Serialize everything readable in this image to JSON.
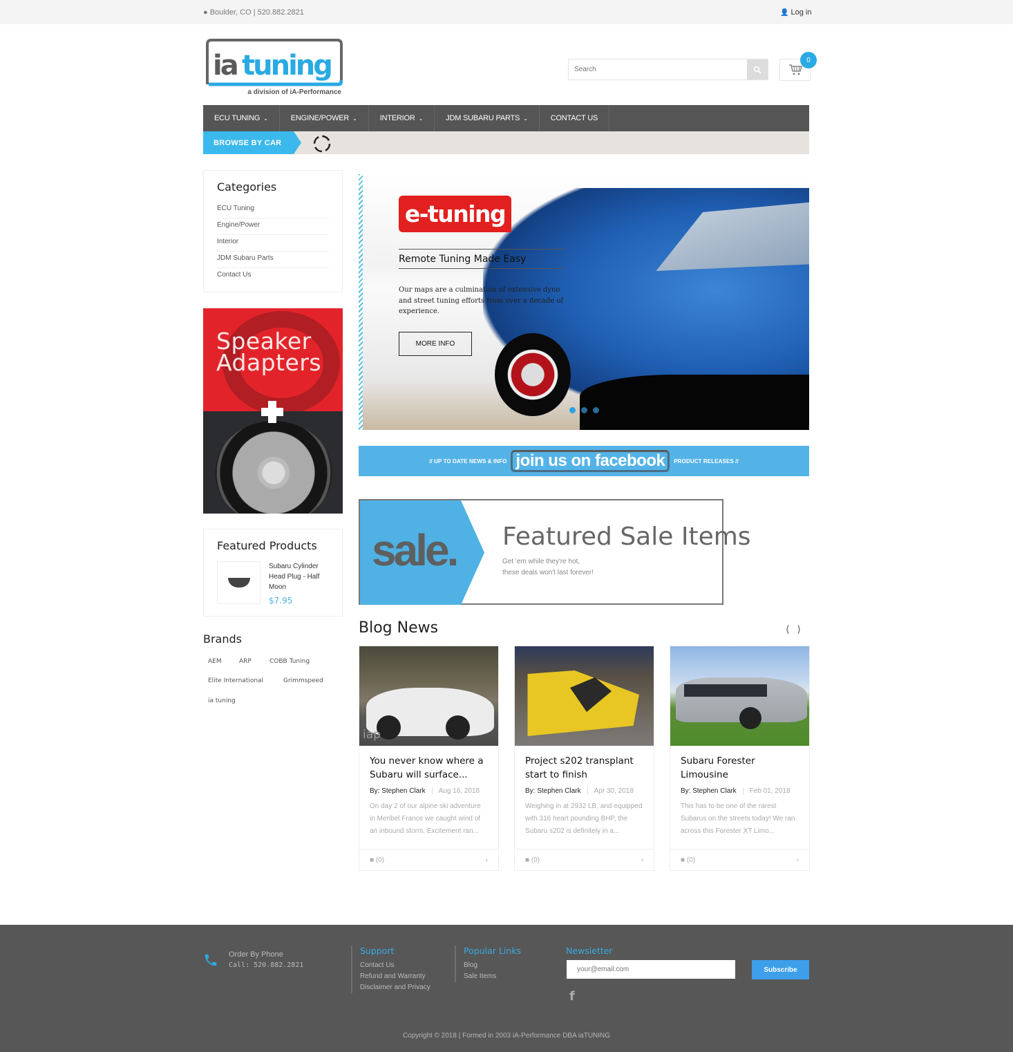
{
  "topbar": {
    "location": "Boulder, CO | 520.882.2821",
    "login": "Log in"
  },
  "logo": {
    "brand_left": "ia",
    "brand_right": "tuning",
    "tagline": "a division of iA-Performance"
  },
  "search": {
    "placeholder": "Search"
  },
  "cart": {
    "count": "0"
  },
  "colors": {
    "accent": "#29aae2",
    "nav_bg": "#555555",
    "footer_bg": "#575757",
    "etuning_red": "#e1201f"
  },
  "nav": {
    "items": [
      {
        "label": "ECU TUNING",
        "dropdown": true
      },
      {
        "label": "ENGINE/POWER",
        "dropdown": true
      },
      {
        "label": "INTERIOR",
        "dropdown": true
      },
      {
        "label": "JDM SUBARU PARTS",
        "dropdown": true
      },
      {
        "label": "CONTACT US",
        "dropdown": false
      }
    ],
    "browse_label": "BROWSE BY CAR"
  },
  "sidebar": {
    "categories_title": "Categories",
    "categories": [
      "ECU Tuning",
      "Engine/Power",
      "Interior",
      "JDM Subaru Parts",
      "Contact Us"
    ],
    "promo_line1": "Speaker",
    "promo_line2": "Adapters",
    "featured_title": "Featured Products",
    "featured_product": {
      "name": "Subaru Cylinder Head Plug - Half Moon",
      "price": "$7.95"
    },
    "brands_title": "Brands",
    "brands": [
      "AEM",
      "ARP",
      "COBB Tuning",
      "Elite International",
      "Grimmspeed",
      "ia tuning"
    ]
  },
  "slider": {
    "badge": "e-tuning",
    "heading": "Remote Tuning Made Easy",
    "text": "Our maps are a culmination of extensive dyno and street tuning efforts from over a decade of experience.",
    "button": "MORE INFO",
    "slide_count": 3,
    "active_slide": 1
  },
  "facebook_banner": {
    "left": "// UP TO DATE NEWS & INFO",
    "center": "join us on facebook",
    "right": "PRODUCT RELEASES //"
  },
  "sale_banner": {
    "word": "sale.",
    "title": "Featured Sale Items",
    "sub1": "Get 'em while they're hot,",
    "sub2": "these deals won't last forever!"
  },
  "blog": {
    "title": "Blog News",
    "posts": [
      {
        "title": "You never know where a Subaru will surface...",
        "author": "By: Stephen Clark",
        "date": "Aug 16, 2018",
        "excerpt": "On day 2 of our alpine ski adventure in Meribel France we caught wind of an inbound storm. Excitement ran...",
        "comments": "(0)",
        "watermark": "iap"
      },
      {
        "title": "Project s202 transplant start to finish",
        "author": "By: Stephen Clark",
        "date": "Apr 30, 2018",
        "excerpt": "Weighing in at  2932 LB, and equipped with 316 heart pounding BHP, the Subaru s202 is definitely in a...",
        "comments": "(0)"
      },
      {
        "title": "Subaru Forester Limousine",
        "author": "By: Stephen Clark",
        "date": "Feb 01, 2018",
        "excerpt": "This has to be one of the rarest Subarus on the streets today! We ran across this Forester XT Limo...",
        "comments": "(0)"
      }
    ]
  },
  "footer": {
    "order_label": "Order By Phone",
    "order_phone": "Call: 520.882.2821",
    "support_title": "Support",
    "support_links": [
      "Contact Us",
      "Refund and Warranty",
      "Disclaimer and Privacy"
    ],
    "popular_title": "Popular Links",
    "popular_links": [
      "Blog",
      "Sale Items"
    ],
    "newsletter_title": "Newsletter",
    "email_placeholder": "your@email.com",
    "subscribe": "Subscribe",
    "copyright": "Copyright © 2018 | Formed in 2003 iA-Performance DBA iaTUNING"
  }
}
